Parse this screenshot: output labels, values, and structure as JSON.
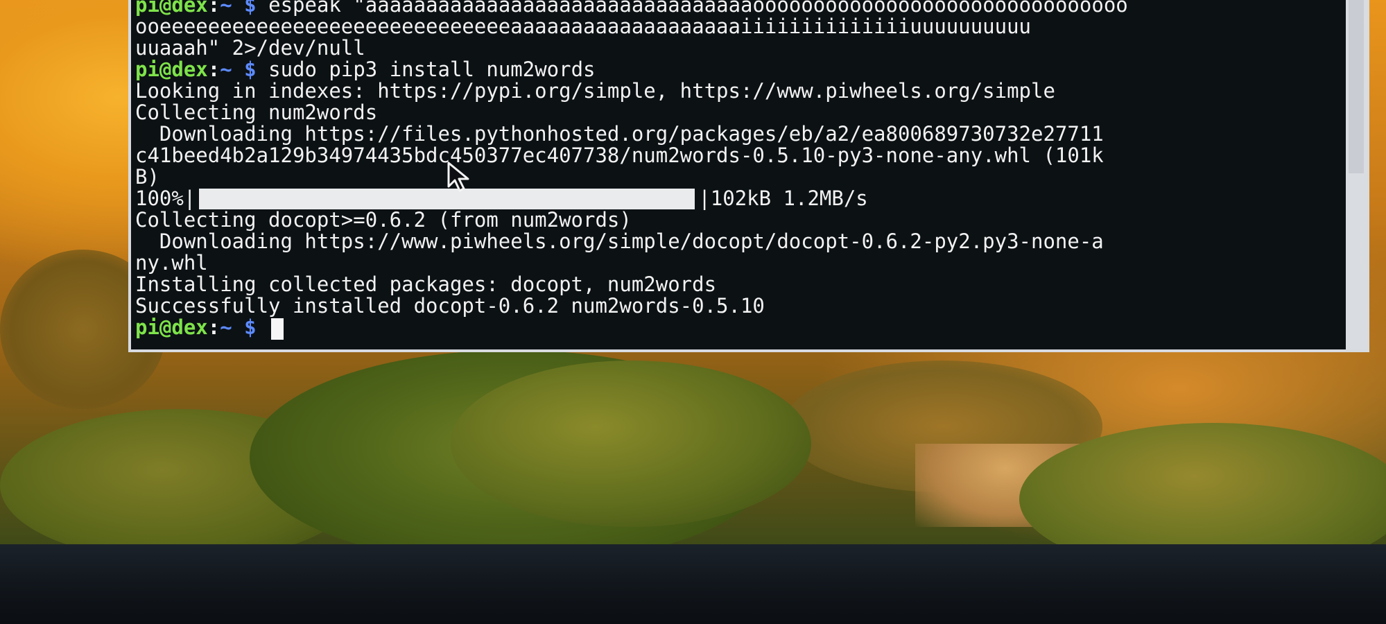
{
  "terminal": {
    "prompt": {
      "user_host": "pi@dex",
      "separator": ":",
      "dir": "~",
      "symbol": "$"
    },
    "lines": {
      "l0": "espeak \"aaaaaaaaaaaaaaaaaaaaaaaaaaaaaaaaooooooooooooooooooooooooooooooo",
      "l1": "ooeeeeeeeeeeeeeeeeeeeeeeeeeeeeeaaaaaaaaaaaaaaaaaaaiiiiiiiiiiiiiiuuuuuuuuuu",
      "l2": "uuaaah\" 2>/dev/null",
      "command": "sudo pip3 install num2words",
      "l4": "Looking in indexes: https://pypi.org/simple, https://www.piwheels.org/simple",
      "l5": "Collecting num2words",
      "l6": "  Downloading https://files.pythonhosted.org/packages/eb/a2/ea800689730732e27711",
      "l7": "c41beed4b2a129b34974435bdc450377ec407738/num2words-0.5.10-py3-none-any.whl (101k",
      "l8": "B)",
      "progress_percent_label": "100%",
      "progress_value": 1.0,
      "progress_left_bar": "|",
      "progress_right_bar": "|",
      "progress_stats": "102kB 1.2MB/s",
      "l10": "Collecting docopt>=0.6.2 (from num2words)",
      "l11": "  Downloading https://www.piwheels.org/simple/docopt/docopt-0.6.2-py2.py3-none-a",
      "l12": "ny.whl",
      "l13": "Installing collected packages: docopt, num2words",
      "l14": "Successfully installed docopt-0.6.2 num2words-0.5.10"
    }
  },
  "icons": {
    "mouse_pointer": "arrow-cursor-icon",
    "text_cursor": "block-cursor-icon"
  },
  "colors": {
    "terminal_bg": "#0c1114",
    "prompt_user": "#7ee34a",
    "prompt_dir": "#5d8bff",
    "text": "#f2f2f2"
  }
}
